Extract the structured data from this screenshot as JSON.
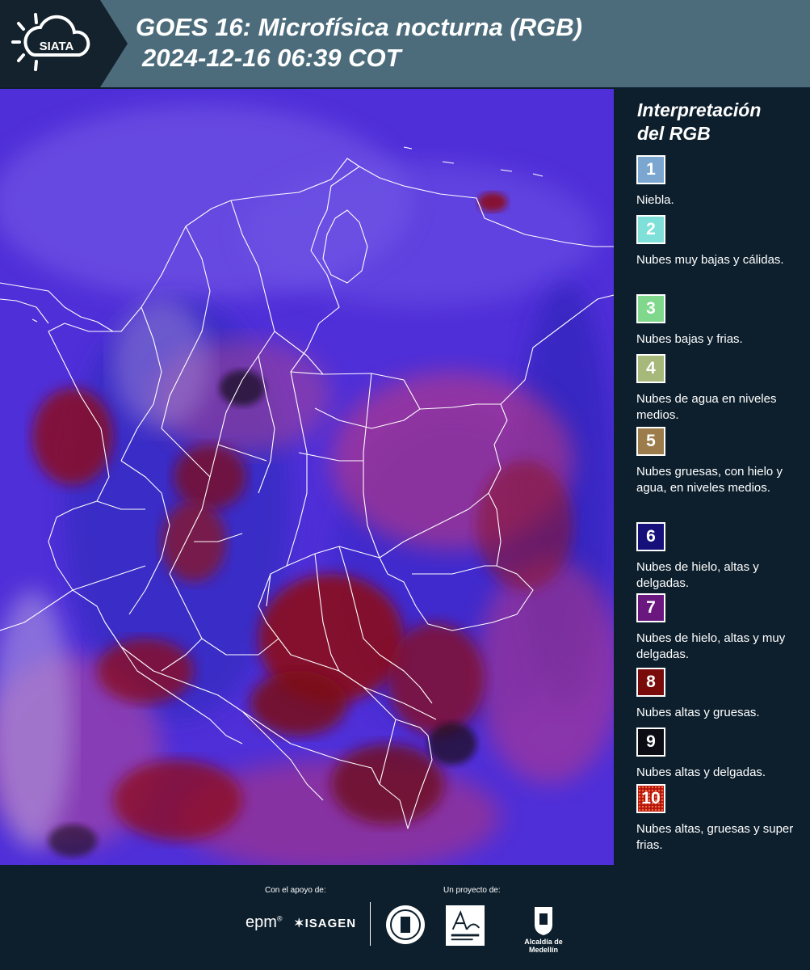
{
  "header": {
    "logo_text": "SIATA",
    "title_line1": "GOES 16: Microfísica nocturna (RGB)",
    "title_line2": "2024-12-16 06:39 COT"
  },
  "legend": {
    "title_line1": "Interpretación",
    "title_line2": "del RGB",
    "items": [
      {
        "number": "1",
        "label": "Niebla.",
        "color": "#7aa6d0"
      },
      {
        "number": "2",
        "label": "Nubes muy bajas y cálidas.",
        "color": "#7ee0d8"
      },
      {
        "number": "3",
        "label": "Nubes bajas y frias.",
        "color": "#7fd88c"
      },
      {
        "number": "4",
        "label": "Nubes de agua en niveles medios.",
        "color": "#a6b87a"
      },
      {
        "number": "5",
        "label": "Nubes gruesas, con hielo y agua, en niveles medios.",
        "color": "#9c7c4a"
      },
      {
        "number": "6",
        "label": "Nubes de hielo, altas y delgadas.",
        "color": "#16117a"
      },
      {
        "number": "7",
        "label": "Nubes de hielo, altas y muy delgadas.",
        "color": "#6a1780"
      },
      {
        "number": "8",
        "label": "Nubes altas y gruesas.",
        "color": "#7a0b0b"
      },
      {
        "number": "9",
        "label": "Nubes altas y delgadas.",
        "color": "#0c0c14"
      },
      {
        "number": "10",
        "label": "Nubes altas, gruesas y super frias.",
        "color": "#b8120e"
      }
    ]
  },
  "footer": {
    "support_label": "Con el apoyo de:",
    "project_label": "Un proyecto de:",
    "epm": "epm",
    "isagen": "ISAGEN",
    "medellin": "Alcaldía de Medellín"
  },
  "colors": {
    "header_bg": "#4c6c7c",
    "panel_bg": "#0d1f2d",
    "map_base": "#4f2fd8",
    "cloud_red": "#8a0f1e",
    "cloud_pink": "#c83a7a",
    "cloud_blue": "#2a2ab8"
  }
}
